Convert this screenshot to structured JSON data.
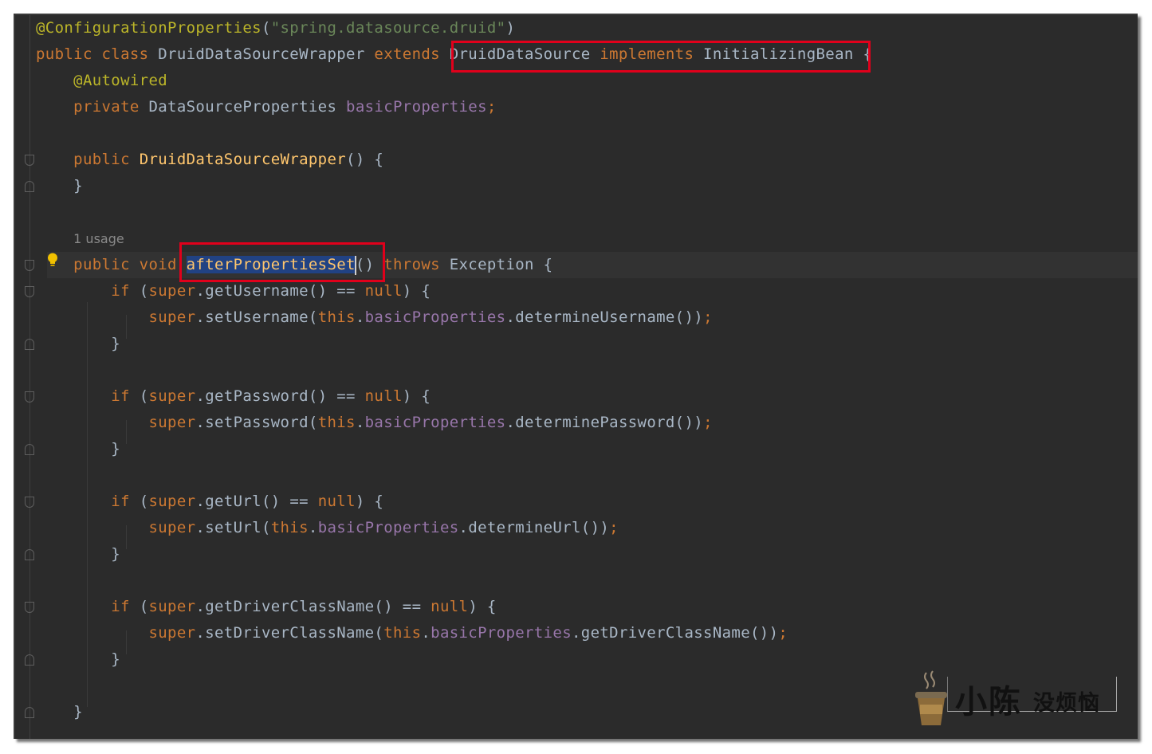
{
  "code": {
    "lines": [
      [
        {
          "t": "@ConfigurationProperties",
          "c": "ann"
        },
        {
          "t": "(",
          "c": "txt"
        },
        {
          "t": "\"spring.datasource.druid\"",
          "c": "str"
        },
        {
          "t": ")",
          "c": "txt"
        }
      ],
      [
        {
          "t": "public class ",
          "c": "kw"
        },
        {
          "t": "DruidDataSourceWrapper ",
          "c": "txt"
        },
        {
          "t": "extends ",
          "c": "kw"
        },
        {
          "t": "DruidDataSource ",
          "c": "txt"
        },
        {
          "t": "implements ",
          "c": "kw"
        },
        {
          "t": "InitializingBean ",
          "c": "txt"
        },
        {
          "t": "{",
          "c": "txt"
        }
      ],
      [
        {
          "t": "    @Autowired",
          "c": "ann"
        }
      ],
      [
        {
          "t": "    private ",
          "c": "kw"
        },
        {
          "t": "DataSourceProperties ",
          "c": "txt"
        },
        {
          "t": "basicProperties",
          "c": "fld"
        },
        {
          "t": ";",
          "c": "kw"
        }
      ],
      [],
      [
        {
          "t": "    public ",
          "c": "kw"
        },
        {
          "t": "DruidDataSourceWrapper",
          "c": "fn"
        },
        {
          "t": "() {",
          "c": "txt"
        }
      ],
      [
        {
          "t": "    }",
          "c": "txt"
        }
      ],
      [],
      [
        {
          "t": "    ",
          "c": "txt"
        },
        {
          "t": "1 usage",
          "c": "usage"
        }
      ],
      [
        {
          "t": "    public void ",
          "c": "kw"
        },
        {
          "t": "afterPropertiesSet",
          "c": "fn sel",
          "caret": true
        },
        {
          "t": "() ",
          "c": "txt"
        },
        {
          "t": "throws ",
          "c": "kw"
        },
        {
          "t": "Exception {",
          "c": "txt"
        }
      ],
      [
        {
          "t": "        if ",
          "c": "kw"
        },
        {
          "t": "(",
          "c": "txt"
        },
        {
          "t": "super",
          "c": "kw"
        },
        {
          "t": ".getUsername() == ",
          "c": "txt"
        },
        {
          "t": "null",
          "c": "kw"
        },
        {
          "t": ") {",
          "c": "txt"
        }
      ],
      [
        {
          "t": "            super",
          "c": "kw"
        },
        {
          "t": ".setUsername(",
          "c": "txt"
        },
        {
          "t": "this",
          "c": "kw"
        },
        {
          "t": ".",
          "c": "txt"
        },
        {
          "t": "basicProperties",
          "c": "fld"
        },
        {
          "t": ".determineUsername())",
          "c": "txt"
        },
        {
          "t": ";",
          "c": "kw"
        }
      ],
      [
        {
          "t": "        }",
          "c": "txt"
        }
      ],
      [],
      [
        {
          "t": "        if ",
          "c": "kw"
        },
        {
          "t": "(",
          "c": "txt"
        },
        {
          "t": "super",
          "c": "kw"
        },
        {
          "t": ".getPassword() == ",
          "c": "txt"
        },
        {
          "t": "null",
          "c": "kw"
        },
        {
          "t": ") {",
          "c": "txt"
        }
      ],
      [
        {
          "t": "            super",
          "c": "kw"
        },
        {
          "t": ".setPassword(",
          "c": "txt"
        },
        {
          "t": "this",
          "c": "kw"
        },
        {
          "t": ".",
          "c": "txt"
        },
        {
          "t": "basicProperties",
          "c": "fld"
        },
        {
          "t": ".determinePassword())",
          "c": "txt"
        },
        {
          "t": ";",
          "c": "kw"
        }
      ],
      [
        {
          "t": "        }",
          "c": "txt"
        }
      ],
      [],
      [
        {
          "t": "        if ",
          "c": "kw"
        },
        {
          "t": "(",
          "c": "txt"
        },
        {
          "t": "super",
          "c": "kw"
        },
        {
          "t": ".getUrl() == ",
          "c": "txt"
        },
        {
          "t": "null",
          "c": "kw"
        },
        {
          "t": ") {",
          "c": "txt"
        }
      ],
      [
        {
          "t": "            super",
          "c": "kw"
        },
        {
          "t": ".setUrl(",
          "c": "txt"
        },
        {
          "t": "this",
          "c": "kw"
        },
        {
          "t": ".",
          "c": "txt"
        },
        {
          "t": "basicProperties",
          "c": "fld"
        },
        {
          "t": ".determineUrl())",
          "c": "txt"
        },
        {
          "t": ";",
          "c": "kw"
        }
      ],
      [
        {
          "t": "        }",
          "c": "txt"
        }
      ],
      [],
      [
        {
          "t": "        if ",
          "c": "kw"
        },
        {
          "t": "(",
          "c": "txt"
        },
        {
          "t": "super",
          "c": "kw"
        },
        {
          "t": ".getDriverClassName() == ",
          "c": "txt"
        },
        {
          "t": "null",
          "c": "kw"
        },
        {
          "t": ") {",
          "c": "txt"
        }
      ],
      [
        {
          "t": "            super",
          "c": "kw"
        },
        {
          "t": ".setDriverClassName(",
          "c": "txt"
        },
        {
          "t": "this",
          "c": "kw"
        },
        {
          "t": ".",
          "c": "txt"
        },
        {
          "t": "basicProperties",
          "c": "fld"
        },
        {
          "t": ".getDriverClassName())",
          "c": "txt"
        },
        {
          "t": ";",
          "c": "kw"
        }
      ],
      [
        {
          "t": "        }",
          "c": "txt"
        }
      ],
      [],
      [
        {
          "t": "    }",
          "c": "txt"
        }
      ]
    ]
  },
  "watermark": {
    "main": "小陈",
    "sub": "没烦恼"
  },
  "colors": {
    "editor_bg": "#2b2b2b",
    "keyword": "#cc7832",
    "annotation": "#bbb529",
    "string": "#6a8759",
    "field": "#9876aa",
    "method": "#ffc66d",
    "text": "#a9b7c6",
    "selection": "#214283",
    "highlight_box": "#e0001b"
  },
  "icons": [
    "lightbulb-icon",
    "fold-marker-icon",
    "coffee-cup-icon"
  ]
}
